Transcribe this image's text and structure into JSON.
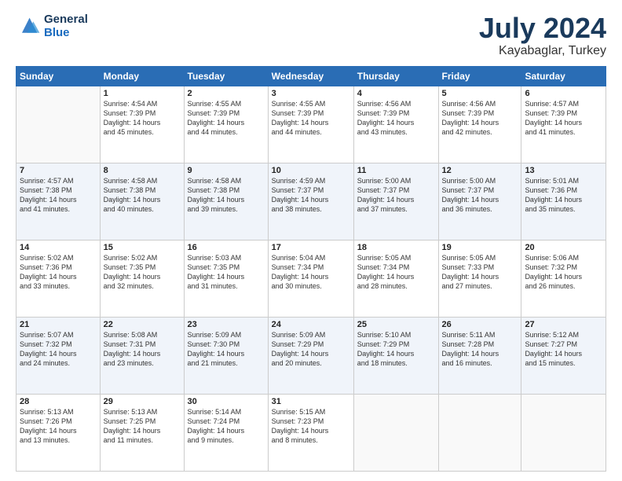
{
  "logo": {
    "line1": "General",
    "line2": "Blue"
  },
  "title": "July 2024",
  "subtitle": "Kayabaglar, Turkey",
  "days_header": [
    "Sunday",
    "Monday",
    "Tuesday",
    "Wednesday",
    "Thursday",
    "Friday",
    "Saturday"
  ],
  "weeks": [
    [
      {
        "day": "",
        "info": ""
      },
      {
        "day": "1",
        "info": "Sunrise: 4:54 AM\nSunset: 7:39 PM\nDaylight: 14 hours\nand 45 minutes."
      },
      {
        "day": "2",
        "info": "Sunrise: 4:55 AM\nSunset: 7:39 PM\nDaylight: 14 hours\nand 44 minutes."
      },
      {
        "day": "3",
        "info": "Sunrise: 4:55 AM\nSunset: 7:39 PM\nDaylight: 14 hours\nand 44 minutes."
      },
      {
        "day": "4",
        "info": "Sunrise: 4:56 AM\nSunset: 7:39 PM\nDaylight: 14 hours\nand 43 minutes."
      },
      {
        "day": "5",
        "info": "Sunrise: 4:56 AM\nSunset: 7:39 PM\nDaylight: 14 hours\nand 42 minutes."
      },
      {
        "day": "6",
        "info": "Sunrise: 4:57 AM\nSunset: 7:39 PM\nDaylight: 14 hours\nand 41 minutes."
      }
    ],
    [
      {
        "day": "7",
        "info": "Sunrise: 4:57 AM\nSunset: 7:38 PM\nDaylight: 14 hours\nand 41 minutes."
      },
      {
        "day": "8",
        "info": "Sunrise: 4:58 AM\nSunset: 7:38 PM\nDaylight: 14 hours\nand 40 minutes."
      },
      {
        "day": "9",
        "info": "Sunrise: 4:58 AM\nSunset: 7:38 PM\nDaylight: 14 hours\nand 39 minutes."
      },
      {
        "day": "10",
        "info": "Sunrise: 4:59 AM\nSunset: 7:37 PM\nDaylight: 14 hours\nand 38 minutes."
      },
      {
        "day": "11",
        "info": "Sunrise: 5:00 AM\nSunset: 7:37 PM\nDaylight: 14 hours\nand 37 minutes."
      },
      {
        "day": "12",
        "info": "Sunrise: 5:00 AM\nSunset: 7:37 PM\nDaylight: 14 hours\nand 36 minutes."
      },
      {
        "day": "13",
        "info": "Sunrise: 5:01 AM\nSunset: 7:36 PM\nDaylight: 14 hours\nand 35 minutes."
      }
    ],
    [
      {
        "day": "14",
        "info": "Sunrise: 5:02 AM\nSunset: 7:36 PM\nDaylight: 14 hours\nand 33 minutes."
      },
      {
        "day": "15",
        "info": "Sunrise: 5:02 AM\nSunset: 7:35 PM\nDaylight: 14 hours\nand 32 minutes."
      },
      {
        "day": "16",
        "info": "Sunrise: 5:03 AM\nSunset: 7:35 PM\nDaylight: 14 hours\nand 31 minutes."
      },
      {
        "day": "17",
        "info": "Sunrise: 5:04 AM\nSunset: 7:34 PM\nDaylight: 14 hours\nand 30 minutes."
      },
      {
        "day": "18",
        "info": "Sunrise: 5:05 AM\nSunset: 7:34 PM\nDaylight: 14 hours\nand 28 minutes."
      },
      {
        "day": "19",
        "info": "Sunrise: 5:05 AM\nSunset: 7:33 PM\nDaylight: 14 hours\nand 27 minutes."
      },
      {
        "day": "20",
        "info": "Sunrise: 5:06 AM\nSunset: 7:32 PM\nDaylight: 14 hours\nand 26 minutes."
      }
    ],
    [
      {
        "day": "21",
        "info": "Sunrise: 5:07 AM\nSunset: 7:32 PM\nDaylight: 14 hours\nand 24 minutes."
      },
      {
        "day": "22",
        "info": "Sunrise: 5:08 AM\nSunset: 7:31 PM\nDaylight: 14 hours\nand 23 minutes."
      },
      {
        "day": "23",
        "info": "Sunrise: 5:09 AM\nSunset: 7:30 PM\nDaylight: 14 hours\nand 21 minutes."
      },
      {
        "day": "24",
        "info": "Sunrise: 5:09 AM\nSunset: 7:29 PM\nDaylight: 14 hours\nand 20 minutes."
      },
      {
        "day": "25",
        "info": "Sunrise: 5:10 AM\nSunset: 7:29 PM\nDaylight: 14 hours\nand 18 minutes."
      },
      {
        "day": "26",
        "info": "Sunrise: 5:11 AM\nSunset: 7:28 PM\nDaylight: 14 hours\nand 16 minutes."
      },
      {
        "day": "27",
        "info": "Sunrise: 5:12 AM\nSunset: 7:27 PM\nDaylight: 14 hours\nand 15 minutes."
      }
    ],
    [
      {
        "day": "28",
        "info": "Sunrise: 5:13 AM\nSunset: 7:26 PM\nDaylight: 14 hours\nand 13 minutes."
      },
      {
        "day": "29",
        "info": "Sunrise: 5:13 AM\nSunset: 7:25 PM\nDaylight: 14 hours\nand 11 minutes."
      },
      {
        "day": "30",
        "info": "Sunrise: 5:14 AM\nSunset: 7:24 PM\nDaylight: 14 hours\nand 9 minutes."
      },
      {
        "day": "31",
        "info": "Sunrise: 5:15 AM\nSunset: 7:23 PM\nDaylight: 14 hours\nand 8 minutes."
      },
      {
        "day": "",
        "info": ""
      },
      {
        "day": "",
        "info": ""
      },
      {
        "day": "",
        "info": ""
      }
    ]
  ]
}
